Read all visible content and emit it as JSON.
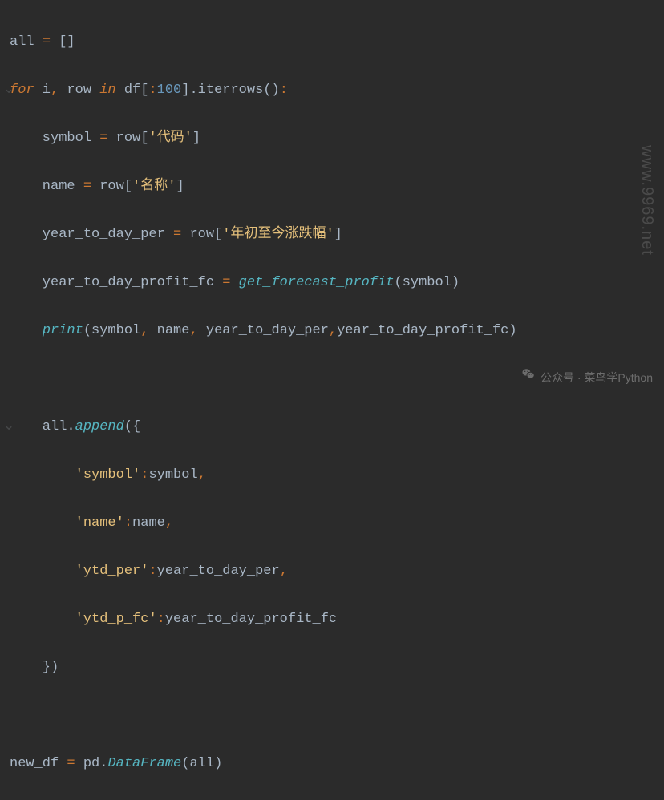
{
  "code": {
    "l1": {
      "a": "all ",
      "b": "=",
      "c": " []"
    },
    "l2": {
      "a": "for",
      "b": " i",
      "c": ",",
      "d": " row ",
      "e": "in",
      "f": " df[",
      "g": ":",
      "h": "100",
      "i": "].iterrows()",
      "j": ":"
    },
    "l3": {
      "a": "    symbol ",
      "b": "=",
      "c": " row[",
      "d": "'代码'",
      "e": "]"
    },
    "l4": {
      "a": "    name ",
      "b": "=",
      "c": " row[",
      "d": "'名称'",
      "e": "]"
    },
    "l5": {
      "a": "    year_to_day_per ",
      "b": "=",
      "c": " row[",
      "d": "'年初至今涨跌幅'",
      "e": "]"
    },
    "l6": {
      "a": "    year_to_day_profit_fc ",
      "b": "=",
      "c": " ",
      "d": "get_forecast_profit",
      "e": "(symbol)"
    },
    "l7": {
      "a": "    ",
      "b": "print",
      "c": "(symbol",
      "d": ",",
      "e": " name",
      "f": ",",
      "g": " year_to_day_per",
      "h": ",",
      "i": "year_to_day_profit_fc)"
    },
    "l8": {
      "a": ""
    },
    "l9": {
      "a": "    all.",
      "b": "append",
      "c": "({"
    },
    "l10": {
      "a": "        ",
      "b": "'symbol'",
      "c": ":",
      "d": "symbol",
      "e": ","
    },
    "l11": {
      "a": "        ",
      "b": "'name'",
      "c": ":",
      "d": "name",
      "e": ","
    },
    "l12": {
      "a": "        ",
      "b": "'ytd_per'",
      "c": ":",
      "d": "year_to_day_per",
      "e": ","
    },
    "l13": {
      "a": "        ",
      "b": "'ytd_p_fc'",
      "c": ":",
      "d": "year_to_day_profit_fc"
    },
    "l14": {
      "a": "    })"
    },
    "l15": {
      "a": ""
    },
    "l16": {
      "a": "new_df ",
      "b": "=",
      "c": " pd.",
      "d": "DataFrame",
      "e": "(all)"
    }
  },
  "watermark": {
    "text": "公众号 · 菜鸟学Python",
    "url": "www.9969.net"
  }
}
